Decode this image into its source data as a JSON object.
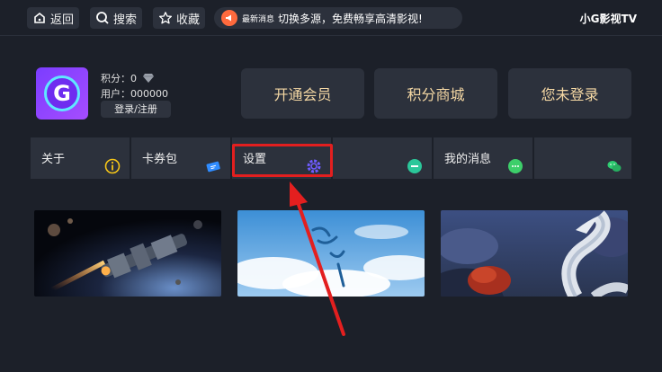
{
  "topbar": {
    "back_label": "返回",
    "search_label": "搜索",
    "favorite_label": "收藏",
    "notice_label": "最新消息",
    "notice_text": "切换多源，免费畅享高清影视!",
    "app_title": "小G影视TV"
  },
  "profile": {
    "avatar_letter": "G",
    "points_label": "积分：0",
    "user_label": "用户：000000",
    "login_label": "登录/注册"
  },
  "actions": {
    "vip_label": "开通会员",
    "shop_label": "积分商城",
    "login_status_label": "您未登录"
  },
  "menu": {
    "items": [
      {
        "label": "关于",
        "icon": "info-icon"
      },
      {
        "label": "卡券包",
        "icon": "ticket-icon"
      },
      {
        "label": "设置",
        "icon": "settings-icon"
      },
      {
        "label": "",
        "icon": "chat-green-icon"
      },
      {
        "label": "我的消息",
        "icon": "message-icon"
      },
      {
        "label": "",
        "icon": "wechat-icon"
      }
    ]
  },
  "colors": {
    "background": "#1c2029",
    "panel": "#2c313c",
    "gold_text": "#f5d8a4",
    "highlight": "#e31f1f"
  }
}
